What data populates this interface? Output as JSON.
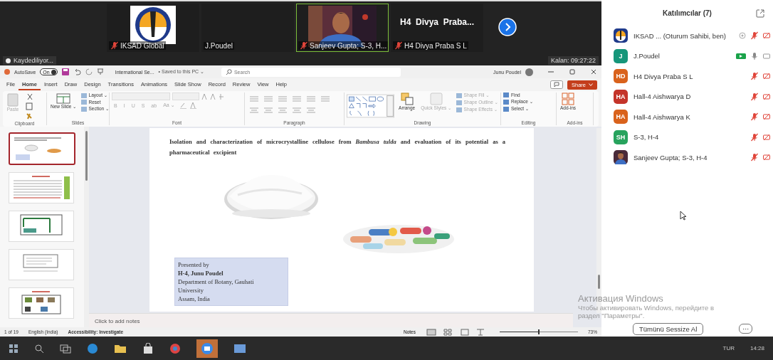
{
  "meeting": {
    "tiles": [
      {
        "kind": "logo",
        "name": "IKSAD Global",
        "muted": true,
        "speaking": false
      },
      {
        "kind": "blank",
        "name": "J.Poudel",
        "muted": false,
        "speaking": false
      },
      {
        "kind": "camera",
        "name": "Sanjeev Gupta; S-3, H...",
        "muted": true,
        "speaking": true
      },
      {
        "kind": "text",
        "title": "H4  Divya  Praba...",
        "name": "H4 Divya Praba S L",
        "muted": true,
        "speaking": false
      }
    ],
    "recording": "Kaydediliyor...",
    "remaining": "Kalan: 09:27:22"
  },
  "powerpoint": {
    "autosave": {
      "label": "AutoSave",
      "state": "On",
      "on": true
    },
    "file_name": "International Se...",
    "save_state": "• Saved to this PC ⌄",
    "search": {
      "placeholder": "Search"
    },
    "user": "Junu Poudel",
    "tabs": [
      {
        "label": "File",
        "selected": false
      },
      {
        "label": "Home",
        "selected": true
      },
      {
        "label": "Insert",
        "selected": false
      },
      {
        "label": "Draw",
        "selected": false
      },
      {
        "label": "Design",
        "selected": false
      },
      {
        "label": "Transitions",
        "selected": false
      },
      {
        "label": "Animations",
        "selected": false
      },
      {
        "label": "Slide Show",
        "selected": false
      },
      {
        "label": "Record",
        "selected": false
      },
      {
        "label": "Review",
        "selected": false
      },
      {
        "label": "View",
        "selected": false
      },
      {
        "label": "Help",
        "selected": false
      }
    ],
    "share": "Share",
    "ribbon": [
      {
        "kind": "clipboard",
        "label": "Clipboard",
        "commands": [
          {
            "label": "Paste",
            "disabled": true
          }
        ]
      },
      {
        "kind": "slides",
        "label": "Slides",
        "commands": [
          {
            "label": "New Slide ⌄",
            "disabled": false
          },
          {
            "label": "Layout ⌄",
            "disabled": false
          },
          {
            "label": "Reset",
            "disabled": false
          },
          {
            "label": "Section ⌄",
            "disabled": false
          }
        ]
      },
      {
        "kind": "font",
        "label": "Font",
        "commands": [
          {
            "label": "B",
            "disabled": true
          },
          {
            "label": "I",
            "disabled": true
          },
          {
            "label": "U",
            "disabled": true
          },
          {
            "label": "S",
            "disabled": true
          },
          {
            "label": "ab",
            "disabled": true
          },
          {
            "label": "Aa ⌄",
            "disabled": true
          }
        ]
      },
      {
        "kind": "paragraph",
        "label": "Paragraph"
      },
      {
        "kind": "drawing",
        "label": "Drawing",
        "commands": [
          {
            "label": "Arrange",
            "disabled": false
          },
          {
            "label": "Quick Styles ⌄",
            "disabled": true
          },
          {
            "label": "Shape Fill ⌄",
            "disabled": true
          },
          {
            "label": "Shape Outline ⌄",
            "disabled": true
          },
          {
            "label": "Shape Effects ⌄",
            "disabled": true
          }
        ]
      },
      {
        "kind": "editing",
        "label": "Editing",
        "commands": [
          {
            "label": "Find",
            "disabled": false
          },
          {
            "label": "Replace ⌄",
            "disabled": false
          },
          {
            "label": "Select ⌄",
            "disabled": false
          }
        ]
      },
      {
        "kind": "addins",
        "label": "Add-ins",
        "commands": [
          {
            "label": "Add-ins",
            "disabled": false
          }
        ]
      }
    ],
    "thumbnails": [
      {
        "selected": true
      },
      {
        "selected": false
      },
      {
        "selected": false
      },
      {
        "selected": false
      },
      {
        "selected": false
      }
    ],
    "slide": {
      "title": "Isolation and characterization of microcrystalline cellulose from *Bambusa tulda* and evaluation of its potential as a pharmaceutical excipient",
      "presenter": [
        {
          "text": "Presented by",
          "bold": false
        },
        {
          "text": "H-4, Junu Poudel",
          "bold": true
        },
        {
          "text": "Department of Botany, Gauhati",
          "bold": false
        },
        {
          "text": "University",
          "bold": false
        },
        {
          "text": "Assam, India",
          "bold": false
        }
      ]
    },
    "notes": {
      "placeholder": "Click to add notes"
    },
    "status_bar": {
      "slide_count": "1 of 19",
      "language": "English (India)",
      "accessibility": "Accessibility: Investigate",
      "notes": "Notes",
      "zoom": {
        "level": 0.5
      },
      "zoom_reading": "73%"
    }
  },
  "participants": {
    "title": "Katılımcılar (7)",
    "items": [
      {
        "kind": "logo",
        "name": "IKSAD ...  (Oturum Sahibi, ben)",
        "recording": true,
        "muted": true,
        "video": false
      },
      {
        "kind": "initials",
        "initials": "J",
        "color": "#16967a",
        "name": "J.Poudel",
        "recording": false,
        "muted": false,
        "video": true
      },
      {
        "kind": "initials",
        "initials": "HD",
        "color": "#d9621c",
        "name": "H4 Divya Praba S L",
        "recording": false,
        "muted": true,
        "video": false
      },
      {
        "kind": "initials",
        "initials": "HA",
        "color": "#c4342a",
        "name": "Hall-4 Aishwarya D",
        "recording": false,
        "muted": true,
        "video": false
      },
      {
        "kind": "initials",
        "initials": "HA",
        "color": "#d9621c",
        "name": "Hall-4 Aishwarya K",
        "recording": false,
        "muted": true,
        "video": false
      },
      {
        "kind": "initials",
        "initials": "SH",
        "color": "#27a35d",
        "name": "S-3, H-4",
        "recording": false,
        "muted": true,
        "video": false
      },
      {
        "name": "Sanjeev Gupta; S-3, H-4",
        "recording": false,
        "muted": true,
        "video": false
      }
    ],
    "mute_all": "Tümünü Sessize Al",
    "more": "···"
  },
  "windows_activation": [
    "Активация Windows",
    "Чтобы активировать Windows, перейдите в",
    "раздел \"Параметры\"."
  ],
  "taskbar": {
    "language": "TUR",
    "clock": "14:28"
  }
}
